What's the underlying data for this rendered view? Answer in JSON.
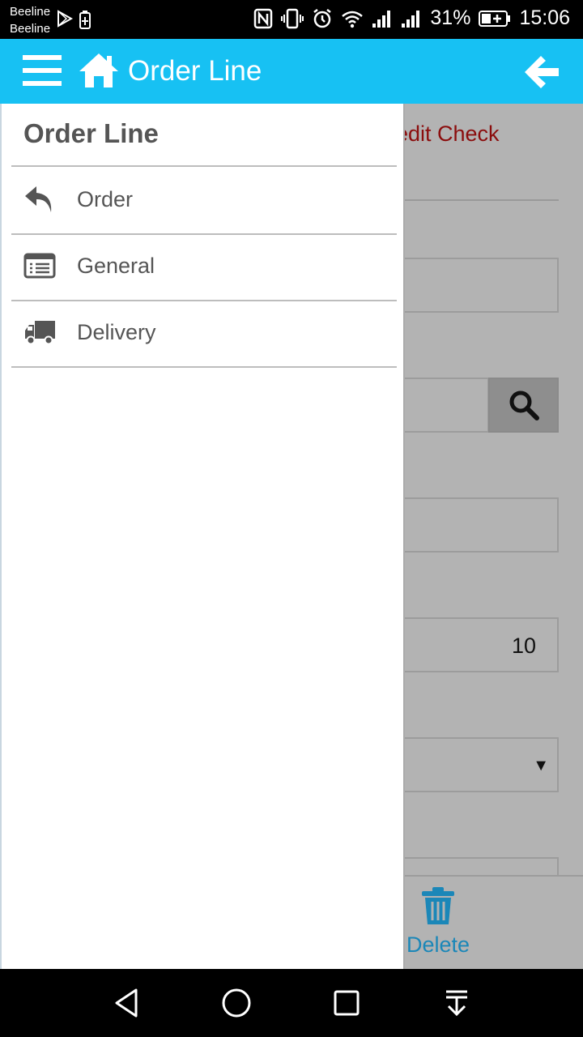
{
  "status_bar": {
    "carrier_1": "Beeline",
    "carrier_2": "Beeline",
    "battery_percent": "31%",
    "time": "15:06",
    "icons": [
      "play-store-icon",
      "battery-saver-icon",
      "nfc-icon",
      "vibrate-icon",
      "alarm-icon",
      "wifi-icon",
      "signal-icon",
      "signal-icon",
      "battery-icon"
    ]
  },
  "appbar": {
    "title": "Order Line",
    "icons": [
      "menu-icon",
      "home-icon",
      "back-arrow-icon"
    ],
    "color": "#17c1f3"
  },
  "background_form": {
    "credit_check": "redit Check",
    "quantity_value": "10",
    "delete_label": "Delete"
  },
  "drawer": {
    "title": "Order Line",
    "items": [
      {
        "label": "Order",
        "icon": "reply-icon"
      },
      {
        "label": "General",
        "icon": "list-icon"
      },
      {
        "label": "Delivery",
        "icon": "truck-icon"
      }
    ]
  },
  "navbar": {
    "icons": [
      "nav-back-icon",
      "nav-home-icon",
      "nav-recents-icon",
      "nav-notifications-icon"
    ]
  }
}
